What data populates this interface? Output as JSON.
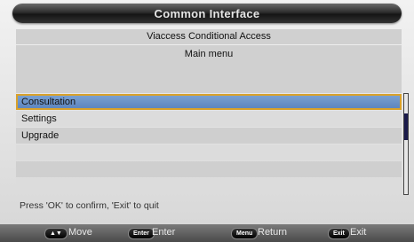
{
  "window": {
    "title": "Common Interface"
  },
  "module_name": "Viaccess Conditional Access",
  "menu_title": "Main menu",
  "menu_items": [
    {
      "label": "Consultation"
    },
    {
      "label": "Settings"
    },
    {
      "label": "Upgrade"
    }
  ],
  "selected_index": 0,
  "hint": "Press 'OK' to confirm, 'Exit' to quit",
  "footer": {
    "keys": [
      {
        "badge": "▲▼",
        "label": "Move"
      },
      {
        "badge": "Enter",
        "label": "Enter"
      },
      {
        "badge": "Menu",
        "label": "Return"
      },
      {
        "badge": "Exit",
        "label": "Exit"
      }
    ]
  },
  "colors": {
    "selected_row": "#6a8fc7",
    "selection_border": "#d9a12a"
  }
}
